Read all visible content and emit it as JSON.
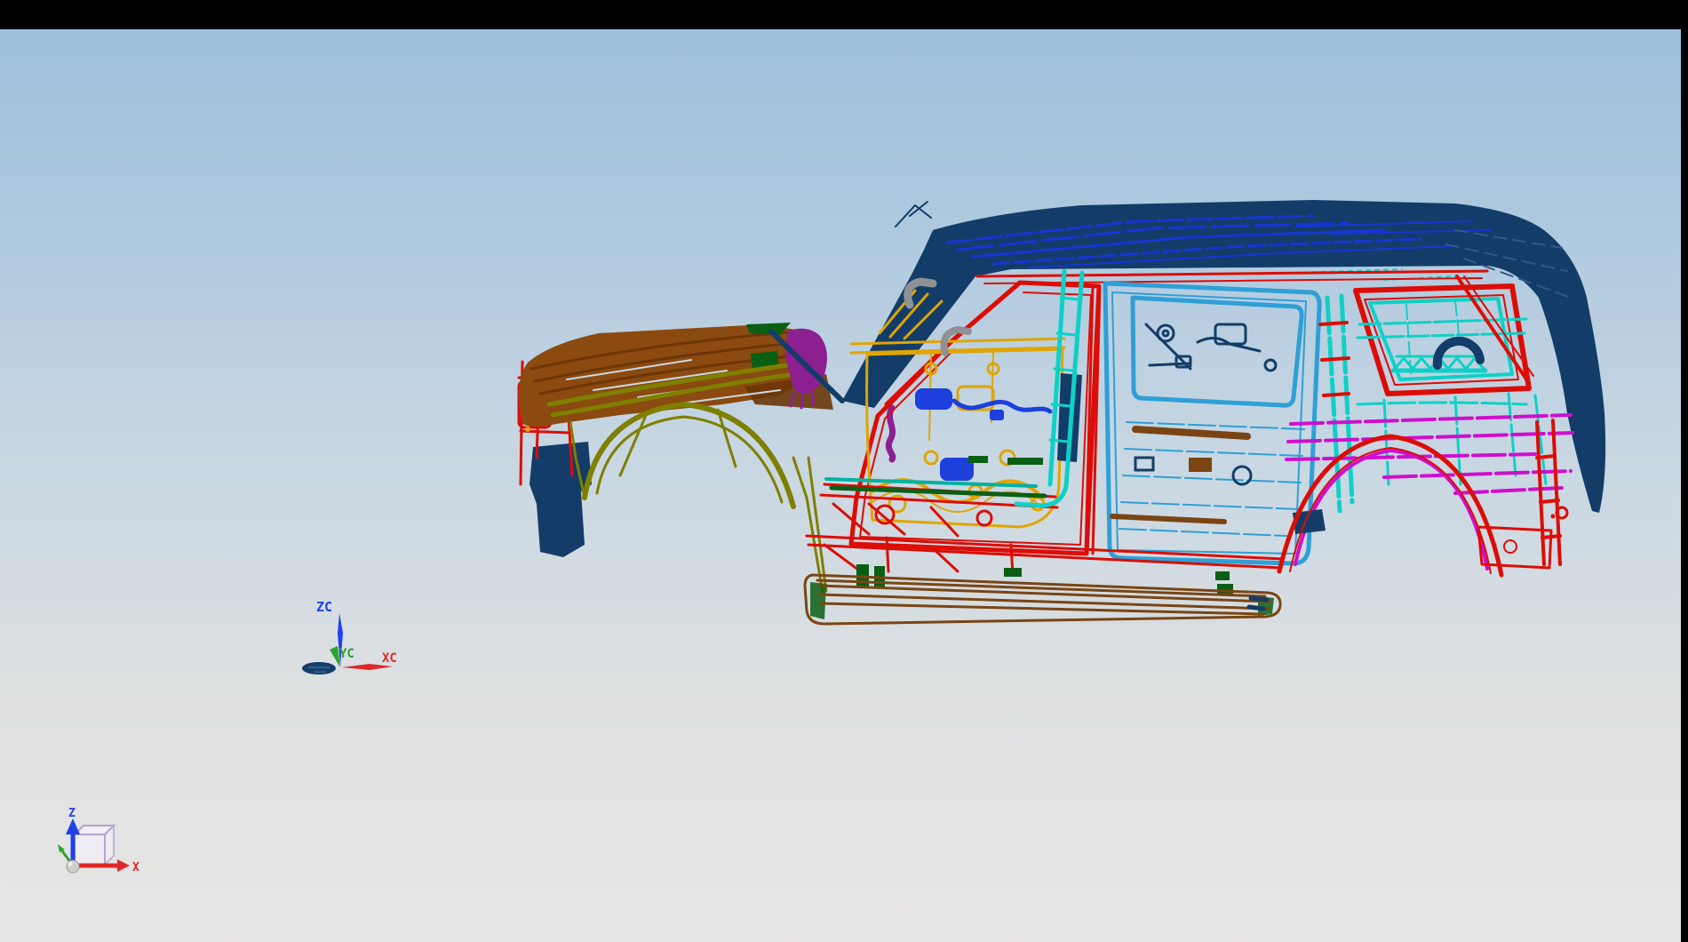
{
  "colors": {
    "frame_black": "#000000",
    "bg_top": "#9cc0dd",
    "bg_upper": "#aec9df",
    "bg_mid": "#c6d6e2",
    "bg_lower": "#dde0e1",
    "bg_bottom": "#e7e6e4",
    "navy": "#133d68",
    "navy_light": "#2c5a86",
    "blue": "#1535d4",
    "component_blue": "#1d3fdc",
    "red": "#dc0d06",
    "maroon": "#6b3608",
    "hood_brown": "#8b4a10",
    "board_brown": "#7a4513",
    "olive": "#7f7f00",
    "gold": "#e0a500",
    "cyan": "#0fd0c6",
    "teal": "#02b2a2",
    "sky": "#2f9fd6",
    "magenta": "#ce0fce",
    "purple": "#8c2090",
    "green": "#0a5f14",
    "gray": "#8e9196",
    "hood_slit": "#c9d9e6",
    "triad_blue": "#2040ee",
    "triad_green": "#2ea22e",
    "triad_red": "#e02828",
    "lavender": "#b5a3c9",
    "cube_face": "#f2eef6",
    "sphere": "#cfcfcf"
  },
  "wcs_triad": {
    "z_label": "ZC",
    "y_label": "YC",
    "x_label": "XC"
  },
  "view_triad": {
    "z_label": "Z",
    "x_label": "X"
  },
  "model": {
    "kind": "SUV body-in-white wireframe, left side view",
    "parts": [
      {
        "name": "radiator-support",
        "color": "red"
      },
      {
        "name": "front-bracket",
        "color": "navy"
      },
      {
        "name": "hood",
        "color": "hood_brown"
      },
      {
        "name": "front-fender",
        "color": "olive"
      },
      {
        "name": "cowl-trim",
        "color": "purple"
      },
      {
        "name": "roof-and-pillars",
        "color": "navy"
      },
      {
        "name": "roof-panel-lines",
        "color": "blue"
      },
      {
        "name": "cant-rail",
        "color": "red"
      },
      {
        "name": "front-door-aperture",
        "color": "red"
      },
      {
        "name": "front-door-inner-panel",
        "color": "gold"
      },
      {
        "name": "door-hardware",
        "color": "component_blue"
      },
      {
        "name": "grab-handles",
        "color": "gray"
      },
      {
        "name": "b-pillar-glass-run",
        "color": "cyan"
      },
      {
        "name": "rear-door",
        "color": "sky"
      },
      {
        "name": "quarter-window-frame",
        "color": "red"
      },
      {
        "name": "quarter-inner-panel",
        "color": "cyan"
      },
      {
        "name": "rear-wheelhouse",
        "color": "magenta"
      },
      {
        "name": "rear-wheel-arch",
        "color": "red"
      },
      {
        "name": "sill-reinforcement",
        "color": "red"
      },
      {
        "name": "running-board",
        "color": "board_brown"
      },
      {
        "name": "floor-strips",
        "color": "green"
      },
      {
        "name": "origin-part",
        "color": "navy"
      }
    ]
  }
}
